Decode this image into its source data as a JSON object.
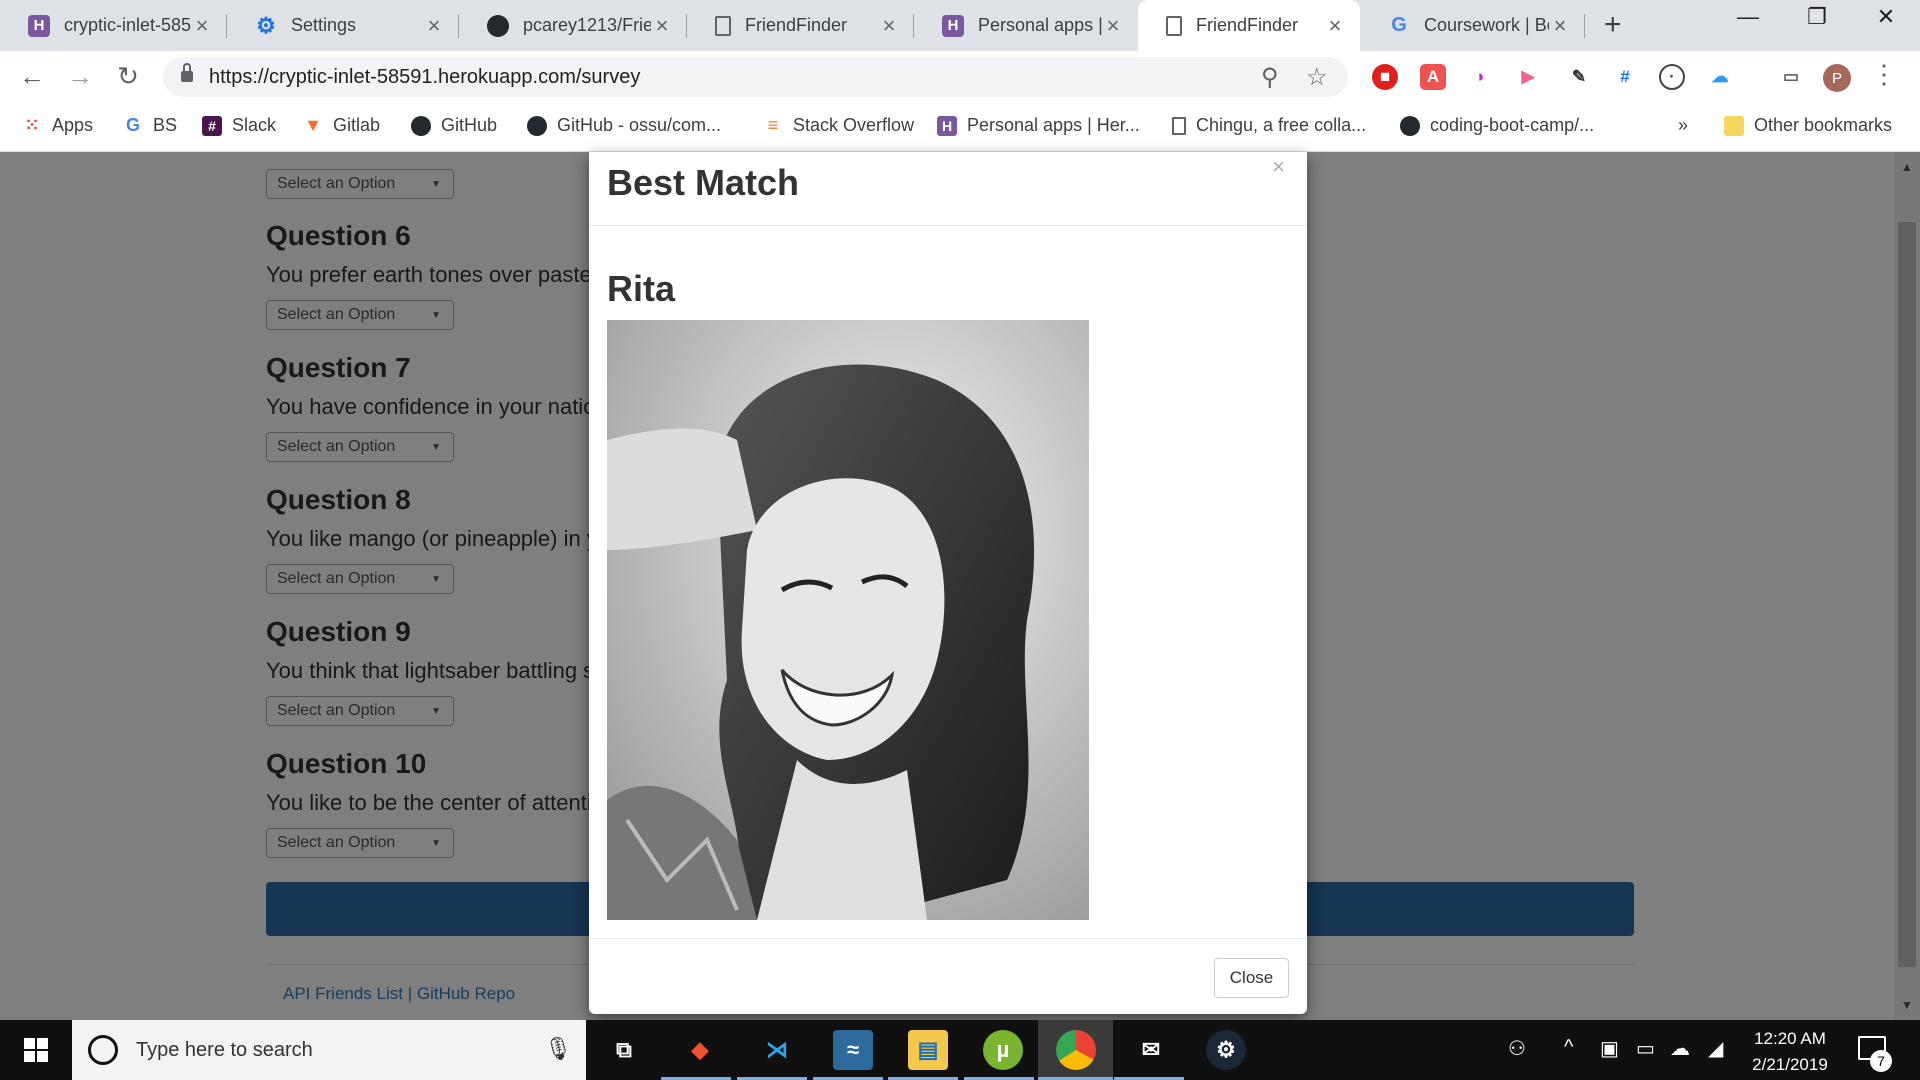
{
  "browser": {
    "tabs": [
      {
        "title": "cryptic-inlet-585",
        "icon": "heroku-icon",
        "active": false
      },
      {
        "title": "Settings",
        "icon": "gear-icon",
        "active": false
      },
      {
        "title": "pcarey1213/Frie",
        "icon": "github-icon",
        "active": false
      },
      {
        "title": "FriendFinder",
        "icon": "document-icon",
        "active": false
      },
      {
        "title": "Personal apps | H",
        "icon": "heroku-icon",
        "active": false
      },
      {
        "title": "FriendFinder",
        "icon": "document-icon",
        "active": true
      },
      {
        "title": "Coursework | Bo",
        "icon": "google-icon",
        "active": false
      }
    ],
    "url": "https://cryptic-inlet-58591.herokuapp.com/survey",
    "bookmarks": [
      {
        "label": "Apps",
        "icon": "apps-grid-icon"
      },
      {
        "label": "BS",
        "icon": "google-icon"
      },
      {
        "label": "Slack",
        "icon": "slack-icon"
      },
      {
        "label": "Gitlab",
        "icon": "gitlab-icon"
      },
      {
        "label": "GitHub",
        "icon": "github-icon"
      },
      {
        "label": "GitHub - ossu/com...",
        "icon": "github-icon"
      },
      {
        "label": "Stack Overflow",
        "icon": "stackoverflow-icon"
      },
      {
        "label": "Personal apps | Her...",
        "icon": "heroku-icon"
      },
      {
        "label": "Chingu, a free colla...",
        "icon": "document-icon"
      },
      {
        "label": "coding-boot-camp/...",
        "icon": "github-icon"
      }
    ],
    "more_bookmarks": "»",
    "other_bookmarks": "Other bookmarks",
    "profile_initial": "P"
  },
  "survey": {
    "questions": [
      {
        "title": "Question 6",
        "text": "You prefer earth tones over pastel"
      },
      {
        "title": "Question 7",
        "text": "You have confidence in your natio"
      },
      {
        "title": "Question 8",
        "text": "You like mango (or pineapple) in y"
      },
      {
        "title": "Question 9",
        "text": "You think that lightsaber battling s"
      },
      {
        "title": "Question 10",
        "text": "You like to be the center of attentio"
      }
    ],
    "select_placeholder": "Select an Option",
    "footer": "API Friends List | GitHub Repo"
  },
  "modal": {
    "title": "Best Match",
    "close_x": "×",
    "match_name": "Rita",
    "close_button": "Close"
  },
  "taskbar": {
    "search_placeholder": "Type here to search",
    "time": "12:20 AM",
    "date": "2/21/2019",
    "notification_count": "7"
  },
  "colors": {
    "heroku": "#79589f",
    "submit_bar": "#2e6da4",
    "link": "#337ab7",
    "taskbar": "#101010"
  }
}
